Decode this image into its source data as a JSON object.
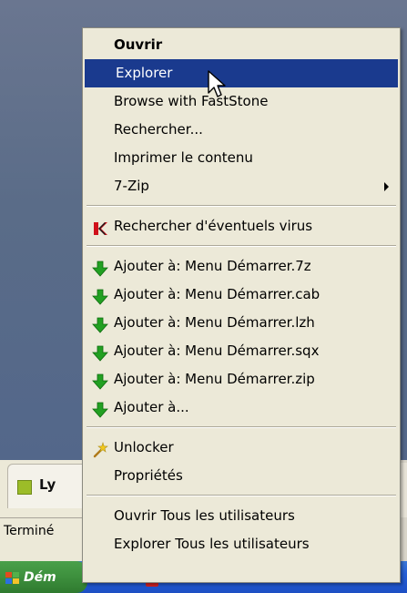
{
  "menu": {
    "items": [
      {
        "label": "Ouvrir"
      },
      {
        "label": "Explorer"
      },
      {
        "label": "Browse with FastStone"
      },
      {
        "label": "Rechercher..."
      },
      {
        "label": "Imprimer le contenu"
      },
      {
        "label": "7-Zip"
      },
      {
        "label": "Rechercher d'éventuels virus"
      },
      {
        "label": "Ajouter à: Menu Démarrer.7z"
      },
      {
        "label": "Ajouter à: Menu Démarrer.cab"
      },
      {
        "label": "Ajouter à: Menu Démarrer.lzh"
      },
      {
        "label": "Ajouter à: Menu Démarrer.sqx"
      },
      {
        "label": "Ajouter à: Menu Démarrer.zip"
      },
      {
        "label": "Ajouter à..."
      },
      {
        "label": "Unlocker"
      },
      {
        "label": "Propriétés"
      },
      {
        "label": "Ouvrir Tous les utilisateurs"
      },
      {
        "label": "Explorer Tous les utilisateurs"
      }
    ],
    "highlighted_item": "Explorer"
  },
  "background": {
    "app_tab_label": "Ly",
    "status_label": "Terminé",
    "start_label": "Dém"
  },
  "colors": {
    "highlight": "#1a3a8e",
    "menu_bg": "#ece9d8",
    "desktop": "#5a6c88",
    "taskbar": "#245ed6",
    "start_green": "#3d8f3d"
  }
}
